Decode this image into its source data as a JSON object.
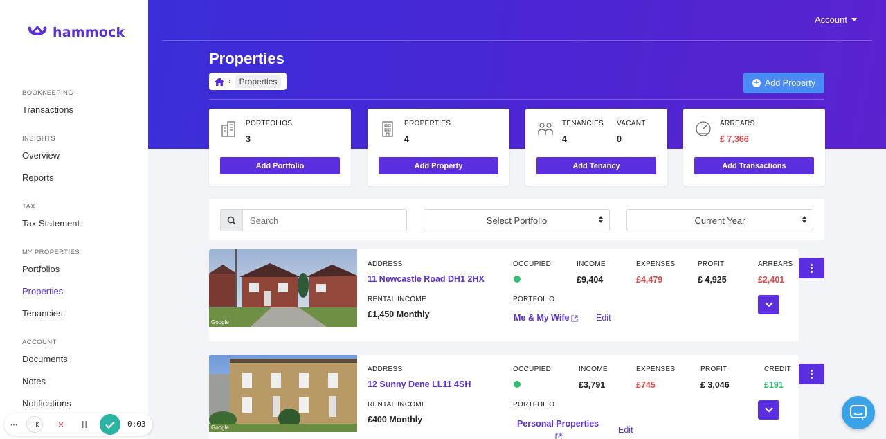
{
  "app": {
    "name": "hammock",
    "brand_color": "#5b2ee0",
    "accent_color": "#4a8cf7"
  },
  "header": {
    "account_label": "Account",
    "page_title": "Properties",
    "breadcrumb": {
      "home_icon": "home-icon",
      "current": "Properties"
    },
    "add_property_label": "Add Property"
  },
  "sidebar": {
    "sections": [
      {
        "title": "BOOKKEEPING",
        "items": [
          "Transactions"
        ]
      },
      {
        "title": "INSIGHTS",
        "items": [
          "Overview",
          "Reports"
        ]
      },
      {
        "title": "TAX",
        "items": [
          "Tax Statement"
        ]
      },
      {
        "title": "MY PROPERTIES",
        "items": [
          "Portfolios",
          "Properties",
          "Tenancies"
        ]
      },
      {
        "title": "ACCOUNT",
        "items": [
          "Documents",
          "Notes",
          "Notifications"
        ]
      }
    ],
    "active_item": "Properties"
  },
  "stats": {
    "portfolios": {
      "label": "PORTFOLIOS",
      "value": "3",
      "button": "Add Portfolio"
    },
    "properties": {
      "label": "PROPERTIES",
      "value": "4",
      "button": "Add Property"
    },
    "tenancies": {
      "label": "TENANCIES",
      "value": "4",
      "vacant_label": "VACANT",
      "vacant_value": "0",
      "button": "Add Tenancy"
    },
    "arrears": {
      "label": "ARREARS",
      "value": "£ 7,366",
      "button": "Add Transactions"
    }
  },
  "filters": {
    "search_placeholder": "Search",
    "portfolio_select": "Select Portfolio",
    "year_select": "Current Year"
  },
  "properties": [
    {
      "address_label": "ADDRESS",
      "address": "11 Newcastle Road DH1 2HX",
      "rental_label": "RENTAL INCOME",
      "rental": "£1,450 Monthly",
      "occupied_label": "OCCUPIED",
      "portfolio_label": "PORTFOLIO",
      "portfolio": "Me & My Wife",
      "edit_label": "Edit",
      "income_label": "INCOME",
      "income": "£9,404",
      "expenses_label": "EXPENSES",
      "expenses": "£4,479",
      "profit_label": "PROFIT",
      "profit": "£ 4,925",
      "balance_label": "ARREARS",
      "balance": "£2,401"
    },
    {
      "address_label": "ADDRESS",
      "address": "12 Sunny Dene LL11 4SH",
      "rental_label": "RENTAL INCOME",
      "rental": "£400 Monthly",
      "occupied_label": "OCCUPIED",
      "portfolio_label": "PORTFOLIO",
      "portfolio": "Personal Properties",
      "edit_label": "Edit",
      "income_label": "INCOME",
      "income": "£3,791",
      "expenses_label": "EXPENSES",
      "expenses": "£745",
      "profit_label": "PROFIT",
      "profit": "£ 3,046",
      "balance_label": "CREDIT",
      "balance": "£191"
    }
  ],
  "recorder": {
    "time": "0:03"
  }
}
